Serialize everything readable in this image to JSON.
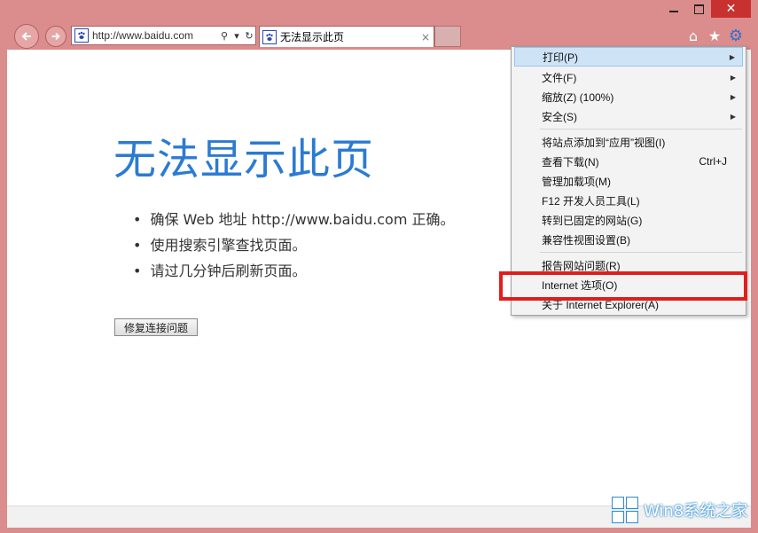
{
  "window": {
    "min_label": "▭",
    "max_label": "□",
    "close_label": "✕"
  },
  "address_bar": {
    "url": "http://www.baidu.com",
    "search_glyph": "⚲",
    "dropdown_glyph": "▾",
    "refresh_glyph": "↻"
  },
  "tab": {
    "title": "无法显示此页",
    "close_glyph": "×"
  },
  "toolbar": {
    "home_glyph": "⌂",
    "favorites_glyph": "★",
    "tools_glyph": "⚙"
  },
  "page": {
    "heading": "无法显示此页",
    "bullets": [
      "确保 Web 地址 http://www.baidu.com 正确。",
      "使用搜索引擎查找页面。",
      "请过几分钟后刷新页面。"
    ],
    "fix_button": "修复连接问题"
  },
  "menu": {
    "items": [
      {
        "label": "打印(P)",
        "arrow": "▶"
      },
      {
        "label": "文件(F)",
        "arrow": "▶"
      },
      {
        "label": "缩放(Z) (100%)",
        "arrow": "▶"
      },
      {
        "label": "安全(S)",
        "arrow": "▶"
      },
      {
        "label": "将站点添加到“应用”视图(I)"
      },
      {
        "label": "查看下载(N)",
        "shortcut": "Ctrl+J"
      },
      {
        "label": "管理加载项(M)"
      },
      {
        "label": "F12 开发人员工具(L)"
      },
      {
        "label": "转到已固定的网站(G)"
      },
      {
        "label": "兼容性视图设置(B)"
      },
      {
        "label": "报告网站问题(R)"
      },
      {
        "label": "Internet 选项(O)"
      },
      {
        "label": "关于 Internet Explorer(A)"
      }
    ]
  },
  "watermark": {
    "text": "Win8系统之家"
  },
  "colors": {
    "frame": "#db8c8c",
    "heading": "#2b7bd2",
    "highlight_box": "#e21d1d",
    "menu_hover": "#cfe3f7"
  }
}
